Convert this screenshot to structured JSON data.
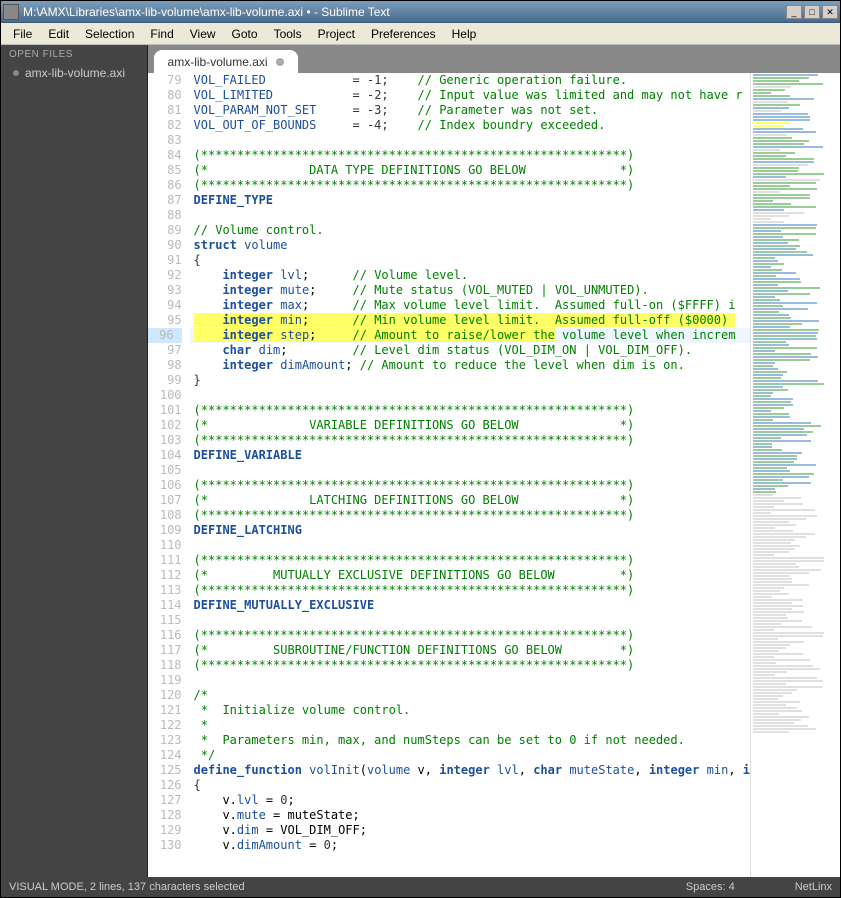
{
  "window": {
    "title": "M:\\AMX\\Libraries\\amx-lib-volume\\amx-lib-volume.axi • - Sublime Text"
  },
  "menu": [
    "File",
    "Edit",
    "Selection",
    "Find",
    "View",
    "Goto",
    "Tools",
    "Project",
    "Preferences",
    "Help"
  ],
  "sidebar": {
    "header": "OPEN FILES",
    "items": [
      "amx-lib-volume.axi"
    ]
  },
  "tab": {
    "name": "amx-lib-volume.axi"
  },
  "lines": [
    {
      "n": 79,
      "html": "<span class='id'>VOL_FAILED</span>            <span class='op'>= -1;</span>    <span class='cm'>// Generic operation failure.</span>"
    },
    {
      "n": 80,
      "html": "<span class='id'>VOL_LIMITED</span>           <span class='op'>= -2;</span>    <span class='cm'>// Input value was limited and may not have r</span>"
    },
    {
      "n": 81,
      "html": "<span class='id'>VOL_PARAM_NOT_SET</span>     <span class='op'>= -3;</span>    <span class='cm'>// Parameter was not set.</span>"
    },
    {
      "n": 82,
      "html": "<span class='id'>VOL_OUT_OF_BOUNDS</span>     <span class='op'>= -4;</span>    <span class='cm'>// Index boundry exceeded.</span>"
    },
    {
      "n": 83,
      "html": ""
    },
    {
      "n": 84,
      "html": "<span class='cm'>(***********************************************************)</span>"
    },
    {
      "n": 85,
      "html": "<span class='cm'>(*              DATA TYPE DEFINITIONS GO BELOW             *)</span>"
    },
    {
      "n": 86,
      "html": "<span class='cm'>(***********************************************************)</span>"
    },
    {
      "n": 87,
      "html": "<span class='kw'>DEFINE_TYPE</span>"
    },
    {
      "n": 88,
      "html": ""
    },
    {
      "n": 89,
      "html": "<span class='cm'>// Volume control.</span>"
    },
    {
      "n": 90,
      "html": "<span class='kw'>struct</span> <span class='id'>volume</span>"
    },
    {
      "n": 91,
      "html": "<span class='op'>{</span>"
    },
    {
      "n": 92,
      "html": "    <span class='kw'>integer</span> <span class='id'>lvl</span>;      <span class='cm'>// Volume level.</span>"
    },
    {
      "n": 93,
      "html": "    <span class='kw'>integer</span> <span class='id'>mute</span>;     <span class='cm'>// Mute status (VOL_MUTED | VOL_UNMUTED).</span>"
    },
    {
      "n": 94,
      "html": "    <span class='kw'>integer</span> <span class='id'>max</span>;      <span class='cm'>// Max volume level limit.  Assumed full-on ($FFFF) i</span>"
    },
    {
      "n": 95,
      "html": "<span class='hl'>    </span><span class='kw hl'>integer</span><span class='hl'> </span><span class='id hl'>min</span><span class='hl'>;      </span><span class='cm hl'>// Min volume level limit.  Assumed full-off ($0000) </span>"
    },
    {
      "n": 96,
      "html": "<span class='hl'>    </span><span class='kw hl'>integer</span><span class='hl'> </span><span class='id hl'>step</span><span class='hl'>;     </span><span class='cm'><span class='hl'>// Amount to raise/lower the</span> volume level when increm</span>",
      "current": true
    },
    {
      "n": 97,
      "html": "    <span class='kw'>char</span> <span class='id'>dim</span>;         <span class='cm'>// Level dim status (VOL_DIM_ON | VOL_DIM_OFF).</span>"
    },
    {
      "n": 98,
      "html": "    <span class='kw'>integer</span> <span class='id'>dimAmount</span>; <span class='cm'>// Amount to reduce the level when dim is on.</span>"
    },
    {
      "n": 99,
      "html": "<span class='op'>}</span>"
    },
    {
      "n": 100,
      "html": ""
    },
    {
      "n": 101,
      "html": "<span class='cm'>(***********************************************************)</span>"
    },
    {
      "n": 102,
      "html": "<span class='cm'>(*              VARIABLE DEFINITIONS GO BELOW              *)</span>"
    },
    {
      "n": 103,
      "html": "<span class='cm'>(***********************************************************)</span>"
    },
    {
      "n": 104,
      "html": "<span class='kw'>DEFINE_VARIABLE</span>"
    },
    {
      "n": 105,
      "html": ""
    },
    {
      "n": 106,
      "html": "<span class='cm'>(***********************************************************)</span>"
    },
    {
      "n": 107,
      "html": "<span class='cm'>(*              LATCHING DEFINITIONS GO BELOW              *)</span>"
    },
    {
      "n": 108,
      "html": "<span class='cm'>(***********************************************************)</span>"
    },
    {
      "n": 109,
      "html": "<span class='kw'>DEFINE_LATCHING</span>"
    },
    {
      "n": 110,
      "html": ""
    },
    {
      "n": 111,
      "html": "<span class='cm'>(***********************************************************)</span>"
    },
    {
      "n": 112,
      "html": "<span class='cm'>(*         MUTUALLY EXCLUSIVE DEFINITIONS GO BELOW         *)</span>"
    },
    {
      "n": 113,
      "html": "<span class='cm'>(***********************************************************)</span>"
    },
    {
      "n": 114,
      "html": "<span class='kw'>DEFINE_MUTUALLY_EXCLUSIVE</span>"
    },
    {
      "n": 115,
      "html": ""
    },
    {
      "n": 116,
      "html": "<span class='cm'>(***********************************************************)</span>"
    },
    {
      "n": 117,
      "html": "<span class='cm'>(*         SUBROUTINE/FUNCTION DEFINITIONS GO BELOW        *)</span>"
    },
    {
      "n": 118,
      "html": "<span class='cm'>(***********************************************************)</span>"
    },
    {
      "n": 119,
      "html": ""
    },
    {
      "n": 120,
      "html": "<span class='cm'>/*</span>"
    },
    {
      "n": 121,
      "html": "<span class='cm'> *  Initialize volume control.</span>"
    },
    {
      "n": 122,
      "html": "<span class='cm'> *</span>"
    },
    {
      "n": 123,
      "html": "<span class='cm'> *  Parameters min, max, and numSteps can be set to 0 if not needed.</span>"
    },
    {
      "n": 124,
      "html": "<span class='cm'> */</span>"
    },
    {
      "n": 125,
      "html": "<span class='kw'>define_function</span> <span class='id'>volInit</span>(<span class='id'>volume</span> v, <span class='kw'>integer</span> <span class='id'>lvl</span>, <span class='kw'>char</span> <span class='id'>muteState</span>, <span class='kw'>integer</span> <span class='id'>min</span>, <span class='kw'>i</span>"
    },
    {
      "n": 126,
      "html": "<span class='op'>{</span>"
    },
    {
      "n": 127,
      "html": "    v.<span class='id'>lvl</span> = <span class='num'>0</span>;"
    },
    {
      "n": 128,
      "html": "    v.<span class='id'>mute</span> = muteState;"
    },
    {
      "n": 129,
      "html": "    v.<span class='id'>dim</span> = VOL_DIM_OFF;"
    },
    {
      "n": 130,
      "html": "    v.<span class='id'>dimAmount</span> = <span class='num'>0</span>;"
    }
  ],
  "status": {
    "left": "VISUAL MODE, 2 lines, 137 characters selected",
    "spaces": "Spaces: 4",
    "syntax": "NetLinx"
  }
}
